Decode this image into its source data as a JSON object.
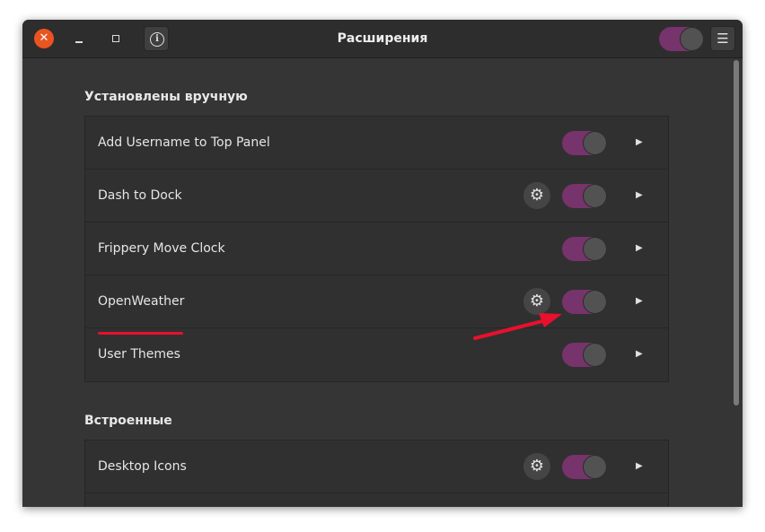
{
  "window": {
    "title": "Расширения",
    "close_glyph": "✕",
    "info_glyph": "i",
    "menu_glyph": "☰"
  },
  "sections": [
    {
      "title": "Установлены вручную",
      "rows": [
        {
          "name": "Add Username to Top Panel",
          "has_settings": false,
          "enabled": true
        },
        {
          "name": "Dash to Dock",
          "has_settings": true,
          "enabled": true
        },
        {
          "name": "Frippery Move Clock",
          "has_settings": false,
          "enabled": true
        },
        {
          "name": "OpenWeather",
          "has_settings": true,
          "enabled": true
        },
        {
          "name": "User Themes",
          "has_settings": false,
          "enabled": true
        }
      ]
    },
    {
      "title": "Встроенные",
      "rows": [
        {
          "name": "Desktop Icons",
          "has_settings": true,
          "enabled": true
        },
        {
          "name": "",
          "has_settings": false,
          "enabled": true
        }
      ]
    }
  ],
  "icons": {
    "gear": "⚙",
    "chevron": "▶"
  },
  "colors": {
    "toggle_on": "#77336b",
    "close_button": "#e95420",
    "annotation": "#e8102e"
  }
}
